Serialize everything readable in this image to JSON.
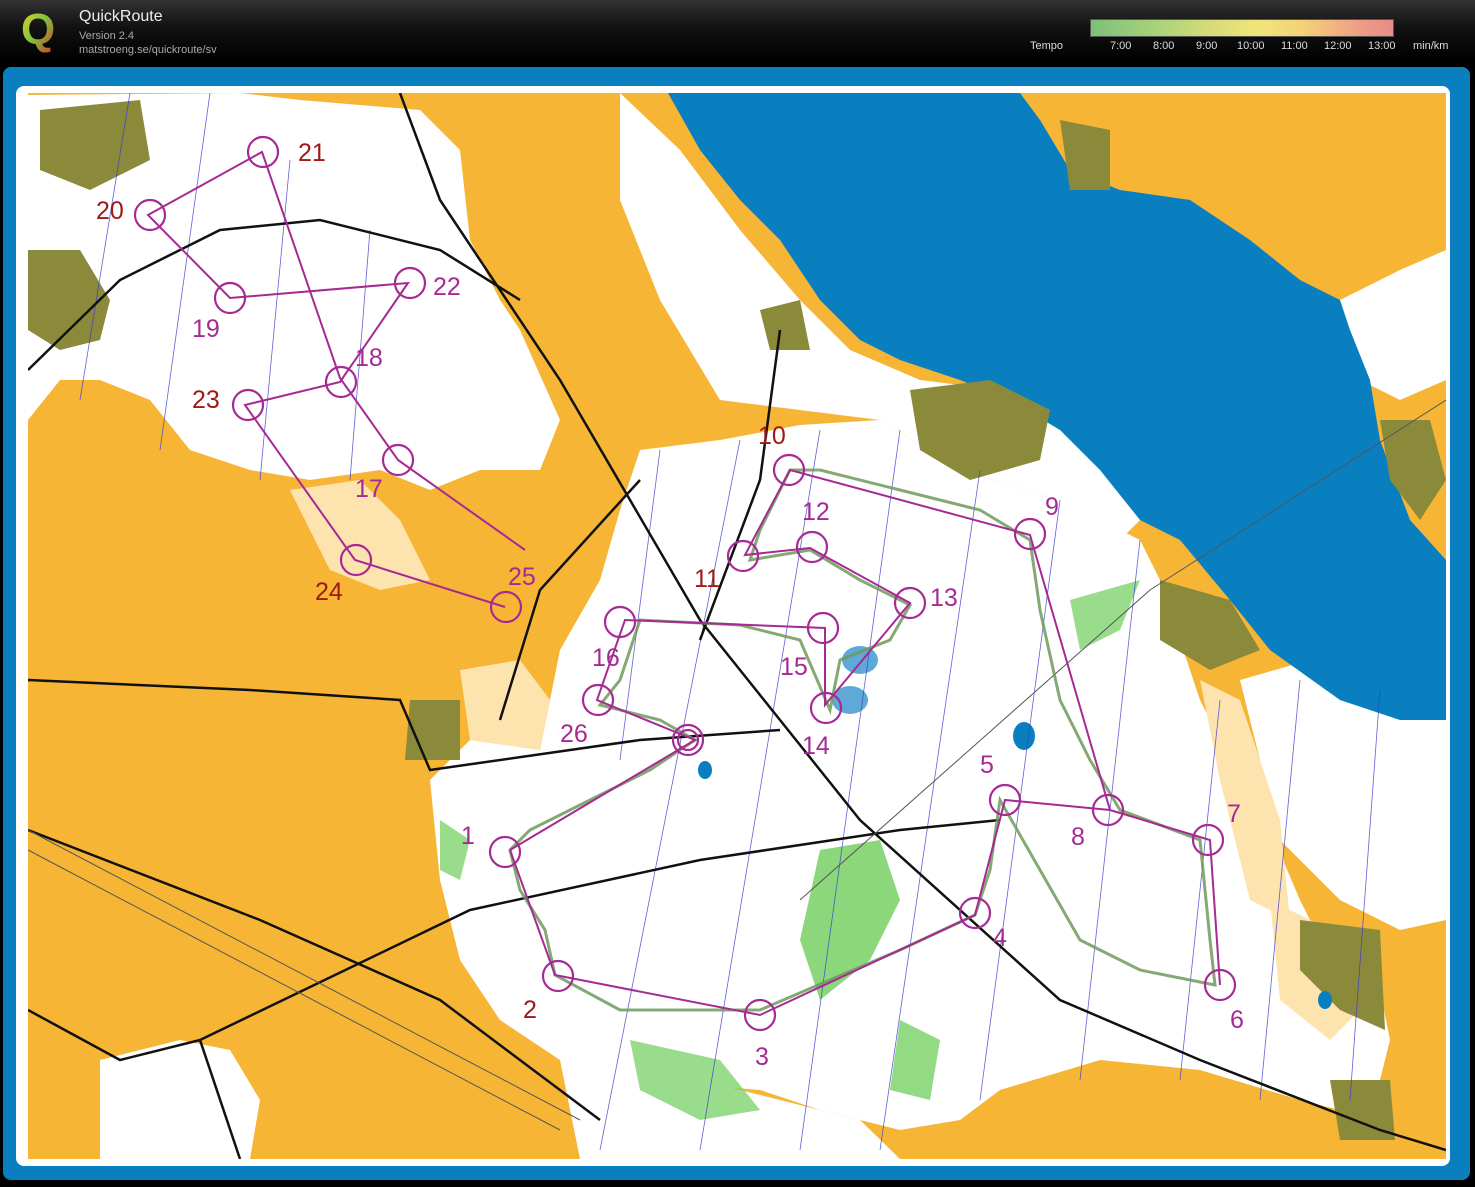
{
  "app": {
    "title": "QuickRoute",
    "version": "Version 2.4",
    "url": "matstroeng.se/quickroute/sv",
    "logo": "Q"
  },
  "tempo": {
    "label": "Tempo",
    "ticks": [
      "7:00",
      "8:00",
      "9:00",
      "10:00",
      "11:00",
      "12:00",
      "13:00"
    ],
    "unit": "min/km"
  },
  "map": {
    "colors": {
      "open": "#f7b535",
      "forest": "#ffffff",
      "water": "#0a7fc0",
      "green": "#7fd36e",
      "urban": "#8b8a3b",
      "course": "#a62a93",
      "route": "#6f9a5a"
    },
    "controls": [
      {
        "n": "1"
      },
      {
        "n": "2"
      },
      {
        "n": "3"
      },
      {
        "n": "4"
      },
      {
        "n": "5"
      },
      {
        "n": "6"
      },
      {
        "n": "7"
      },
      {
        "n": "8"
      },
      {
        "n": "9"
      },
      {
        "n": "10"
      },
      {
        "n": "11"
      },
      {
        "n": "12"
      },
      {
        "n": "13"
      },
      {
        "n": "14"
      },
      {
        "n": "15"
      },
      {
        "n": "16"
      },
      {
        "n": "17"
      },
      {
        "n": "18"
      },
      {
        "n": "19"
      },
      {
        "n": "20"
      },
      {
        "n": "21"
      },
      {
        "n": "22"
      },
      {
        "n": "23"
      },
      {
        "n": "24"
      },
      {
        "n": "25"
      },
      {
        "n": "26"
      }
    ]
  }
}
